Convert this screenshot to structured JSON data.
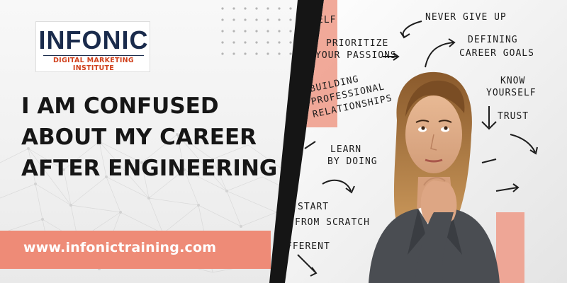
{
  "brand": {
    "logo_text": "INFONIC",
    "logo_subtitle": "DIGITAL MARKETING INSTITUTE",
    "accent_color": "#ee8b77",
    "brand_color": "#1a2b4c",
    "logo_red": "#d0401c"
  },
  "headline": {
    "line1": "I AM CONFUSED",
    "line2": "ABOUT MY CAREER",
    "line3": "AFTER ENGINEERING"
  },
  "website": {
    "url": "www.infonictraining.com"
  },
  "photo": {
    "board_words": [
      "ELF",
      "NEVER GIVE UP",
      "PRIORITIZE",
      "YOUR PASSIONS",
      "DEFINING",
      "CAREER GOALS",
      "KNOW",
      "YOURSELF",
      "BUILDING",
      "PROFESSIONAL",
      "RELATIONSHIPS",
      "TRUST",
      "LEARN",
      "BY DOING",
      "START",
      "FROM SCRATCH",
      "FFERENT"
    ]
  }
}
